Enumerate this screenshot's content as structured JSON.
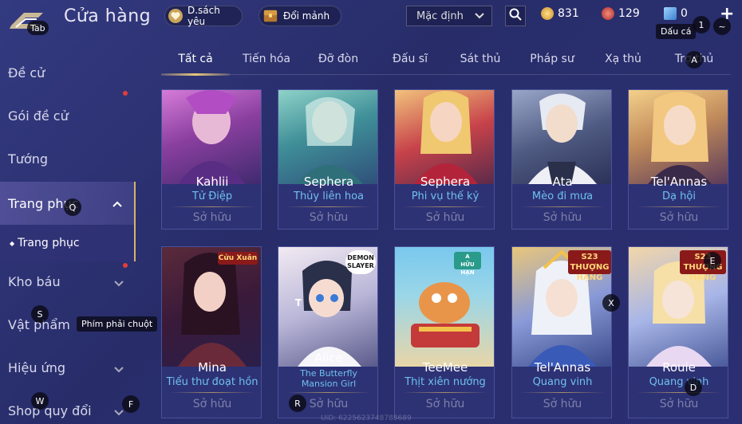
{
  "header": {
    "title": "Cửa hàng",
    "logo_hotkey": "Tab",
    "wishlist_label": "D.sách yêu",
    "exchange_label": "Đổi mảnh",
    "sort_value": "Mặc định",
    "currency": [
      {
        "icon": "gold-coin-icon",
        "value": "831",
        "color": "#e8b548"
      },
      {
        "icon": "red-gem-icon",
        "value": "129",
        "color": "#d44a4a"
      },
      {
        "icon": "blue-voucher-icon",
        "value": "0",
        "color": "#5aa7e8"
      }
    ]
  },
  "hotkeys": {
    "top_1": "1",
    "top_tilde": "~",
    "dau_ca": "Dấu cá",
    "tab_a": "A",
    "q": "Q",
    "s": "S",
    "w": "W",
    "f": "F",
    "t": "T",
    "r": "R",
    "x": "X",
    "e": "E",
    "d": "D",
    "right_click_tip": "Phím phải chuột"
  },
  "sidebar": {
    "items": [
      {
        "label": "Đề cử"
      },
      {
        "label": "Gói đề cử"
      },
      {
        "label": "Tướng"
      },
      {
        "label": "Trang phục"
      },
      {
        "label": "Kho báu"
      },
      {
        "label": "Vật phẩm"
      },
      {
        "label": "Hiệu ứng"
      },
      {
        "label": "Shop quy đổi"
      }
    ],
    "sub_item": "Trang phục"
  },
  "tabs": [
    "Tất cả",
    "Tiến hóa",
    "Đỡ đòn",
    "Đấu sĩ",
    "Sát thủ",
    "Pháp sư",
    "Xạ thủ",
    "Trợ thủ"
  ],
  "cards": [
    {
      "name": "Kahlii",
      "skin": "Tử Điệp",
      "status": "Sở hữu"
    },
    {
      "name": "Sephera",
      "skin": "Thủy liên hoa",
      "status": "Sở hữu"
    },
    {
      "name": "Sephera",
      "skin": "Phi vụ thế kỷ",
      "status": "Sở hữu"
    },
    {
      "name": "Ata",
      "skin": "Mèo đi mưa",
      "status": "Sở hữu"
    },
    {
      "name": "Tel'Annas",
      "skin": "Dạ hội",
      "status": "Sở hữu"
    },
    {
      "name": "Mina",
      "skin": "Tiểu thư đoạt hồn",
      "status": "Sở hữu",
      "badge": "Cửu Xuân"
    },
    {
      "name": "Alice",
      "skin": "The Butterfly Mansion Girl",
      "status": "Sở hữu",
      "badge": "DEMON SLAYER"
    },
    {
      "name": "TeeMee",
      "skin": "Thịt xiên nướng",
      "status": "Sở hữu",
      "badge": "A\nHỮU HẠN"
    },
    {
      "name": "Tel'Annas",
      "skin": "Quang vinh",
      "status": "Sở hữu",
      "badge": "S23\nTHƯỢNG HẠNG"
    },
    {
      "name": "Rouie",
      "skin": "Quang vinh",
      "status": "Sở hữu",
      "badge": "S23\nTHƯỢNG HẠNG"
    }
  ],
  "footer": {
    "uid": "UID: 6225623748788689"
  }
}
